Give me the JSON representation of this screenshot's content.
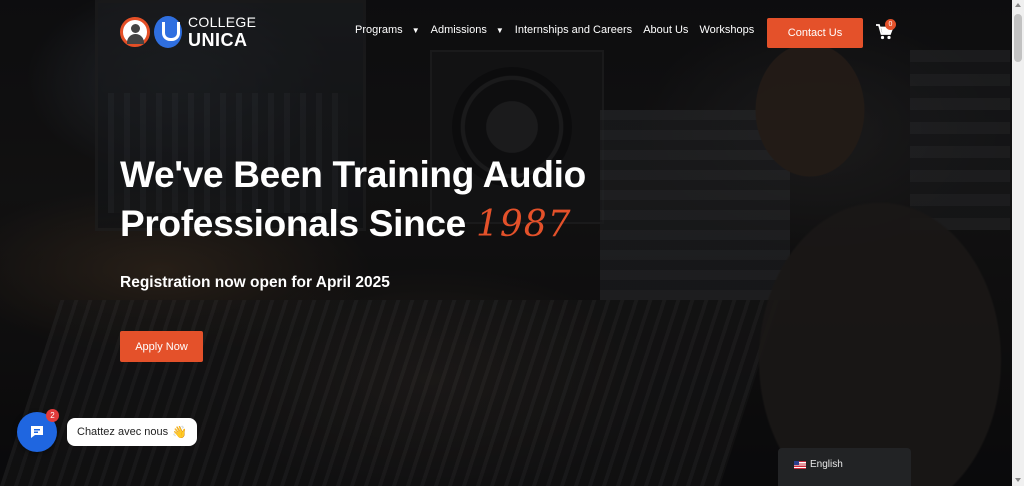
{
  "brand": {
    "line1": "COLLEGE",
    "line2": "UNICA"
  },
  "nav": {
    "items": [
      {
        "label": "Programs",
        "has_dropdown": true
      },
      {
        "label": "Admissions",
        "has_dropdown": true
      },
      {
        "label": "Internships and Careers",
        "has_dropdown": false
      },
      {
        "label": "About Us",
        "has_dropdown": false
      },
      {
        "label": "Workshops",
        "has_dropdown": false
      }
    ],
    "contact_label": "Contact Us",
    "cart_count": "0"
  },
  "hero": {
    "line1": "We've Been Training Audio",
    "line2": "Professionals Since",
    "year": "1987",
    "subtitle": "Registration now open for April 2025",
    "cta_label": "Apply Now"
  },
  "chat": {
    "badge": "2",
    "prompt": "Chattez avec nous",
    "emoji": "👋"
  },
  "language": {
    "current": "English"
  },
  "colors": {
    "accent": "#e4512a",
    "chat_blue": "#1f66e0",
    "logo_blue": "#2f6fe0"
  },
  "icons": {
    "cart": "shopping-cart-icon",
    "chat": "chat-bubble-icon",
    "flag": "us-flag-icon"
  }
}
